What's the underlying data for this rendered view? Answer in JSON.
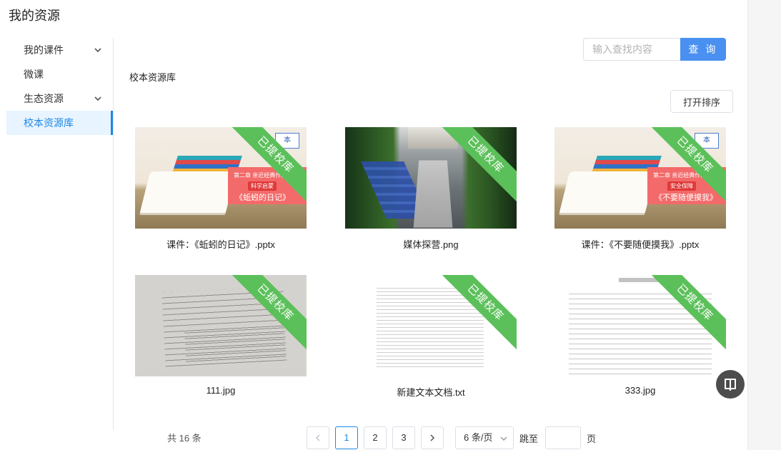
{
  "page": {
    "title": "我的资源"
  },
  "sidebar": {
    "items": [
      {
        "label": "我的课件",
        "has_submenu": true,
        "active": false
      },
      {
        "label": "微课",
        "has_submenu": false,
        "active": false
      },
      {
        "label": "生态资源",
        "has_submenu": true,
        "active": false
      },
      {
        "label": "校本资源库",
        "has_submenu": false,
        "active": true
      }
    ]
  },
  "search": {
    "placeholder": "输入查找内容",
    "value": "",
    "button_label": "查 询"
  },
  "section": {
    "label": "校本资源库"
  },
  "sort_button": {
    "label": "打开排序"
  },
  "resources": [
    {
      "name": "课件：《蚯蚓的日记》.pptx",
      "badge": "已提校库",
      "thumb": "pptx-slide",
      "thumb_text": {
        "line1": "第二章 亲近经典作品",
        "pill": "科学启蒙",
        "line3": "《蚯蚓的日记》",
        "corner": "本"
      }
    },
    {
      "name": "媒体探营.png",
      "badge": "已提校库",
      "thumb": "street-photo"
    },
    {
      "name": "课件：《不要随便摸我》.pptx",
      "badge": "已提校库",
      "thumb": "pptx-slide",
      "thumb_text": {
        "line1": "第二章 亲近经典作品",
        "pill": "安全保障",
        "line3": "《不要随便摸我》",
        "corner": "本"
      }
    },
    {
      "name": "111.jpg",
      "badge": "已提校库",
      "thumb": "document-photo"
    },
    {
      "name": "新建文本文档.txt",
      "badge": "已提校库",
      "thumb": "text-document"
    },
    {
      "name": "333.jpg",
      "badge": "已提校库",
      "thumb": "exam-paper"
    }
  ],
  "pagination": {
    "total_label": "共 16 条",
    "prev_icon": "chevron-left-icon",
    "next_icon": "chevron-right-icon",
    "pages": [
      "1",
      "2",
      "3"
    ],
    "current_page": "1",
    "page_size_label": "6 条/页",
    "jump_label": "跳至",
    "jump_value": "",
    "page_unit": "页"
  },
  "floating_button": {
    "icon": "book-icon"
  },
  "colors": {
    "accent": "#1e88e5",
    "search_button": "#4a90f0",
    "badge": "#5cc05a"
  }
}
